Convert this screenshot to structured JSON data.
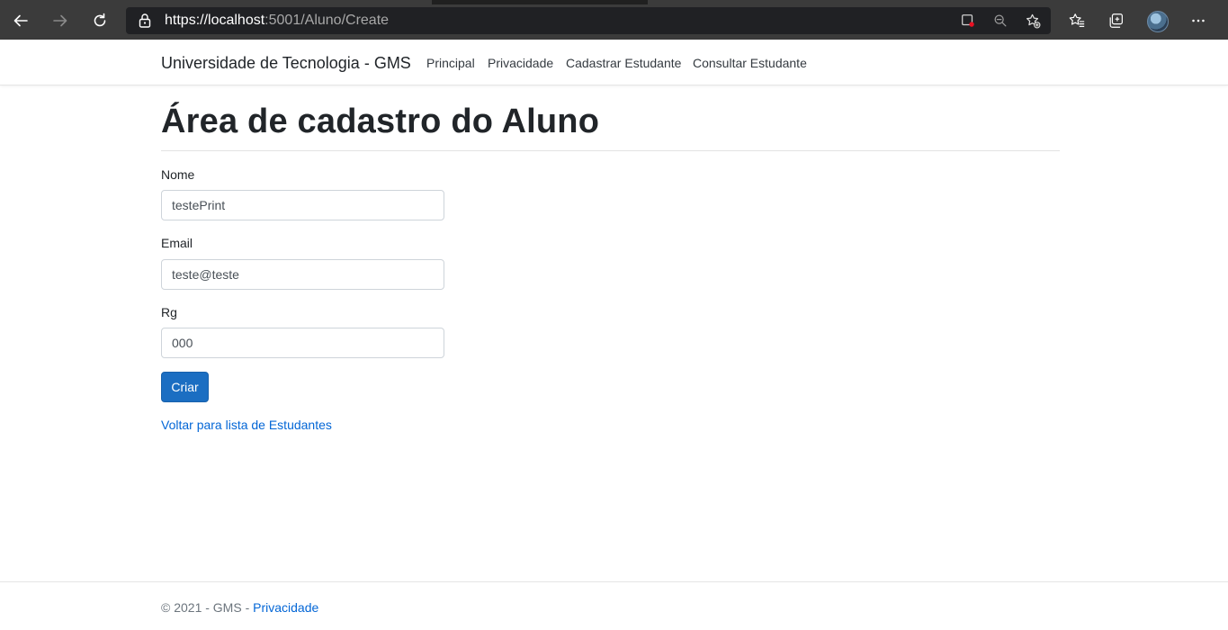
{
  "browser": {
    "url_scheme_host": "https://localhost",
    "url_rest": ":5001/Aluno/Create",
    "icons": [
      "back-arrow-icon",
      "forward-arrow-icon",
      "refresh-icon",
      "lock-icon",
      "screenshot-icon",
      "zoom-out-icon",
      "add-favorite-icon",
      "favorites-icon",
      "collections-icon",
      "profile-avatar",
      "more-options-icon"
    ]
  },
  "navbar": {
    "brand": "Universidade de Tecnologia - GMS",
    "links": [
      "Principal",
      "Privacidade",
      "Cadastrar Estudante",
      "Consultar Estudante"
    ]
  },
  "main": {
    "title": "Área de cadastro do Aluno",
    "fields": [
      {
        "label": "Nome",
        "value": "testePrint"
      },
      {
        "label": "Email",
        "value": "teste@teste"
      },
      {
        "label": "Rg",
        "value": "000"
      }
    ],
    "submit_label": "Criar",
    "back_link": "Voltar para lista de Estudantes"
  },
  "footer": {
    "text": "© 2021 - GMS - ",
    "link": "Privacidade"
  },
  "colors": {
    "primary": "#1b6ec2",
    "link": "#0366d6",
    "browser_toolbar": "#3b3b3b",
    "address_bar": "#202124"
  }
}
